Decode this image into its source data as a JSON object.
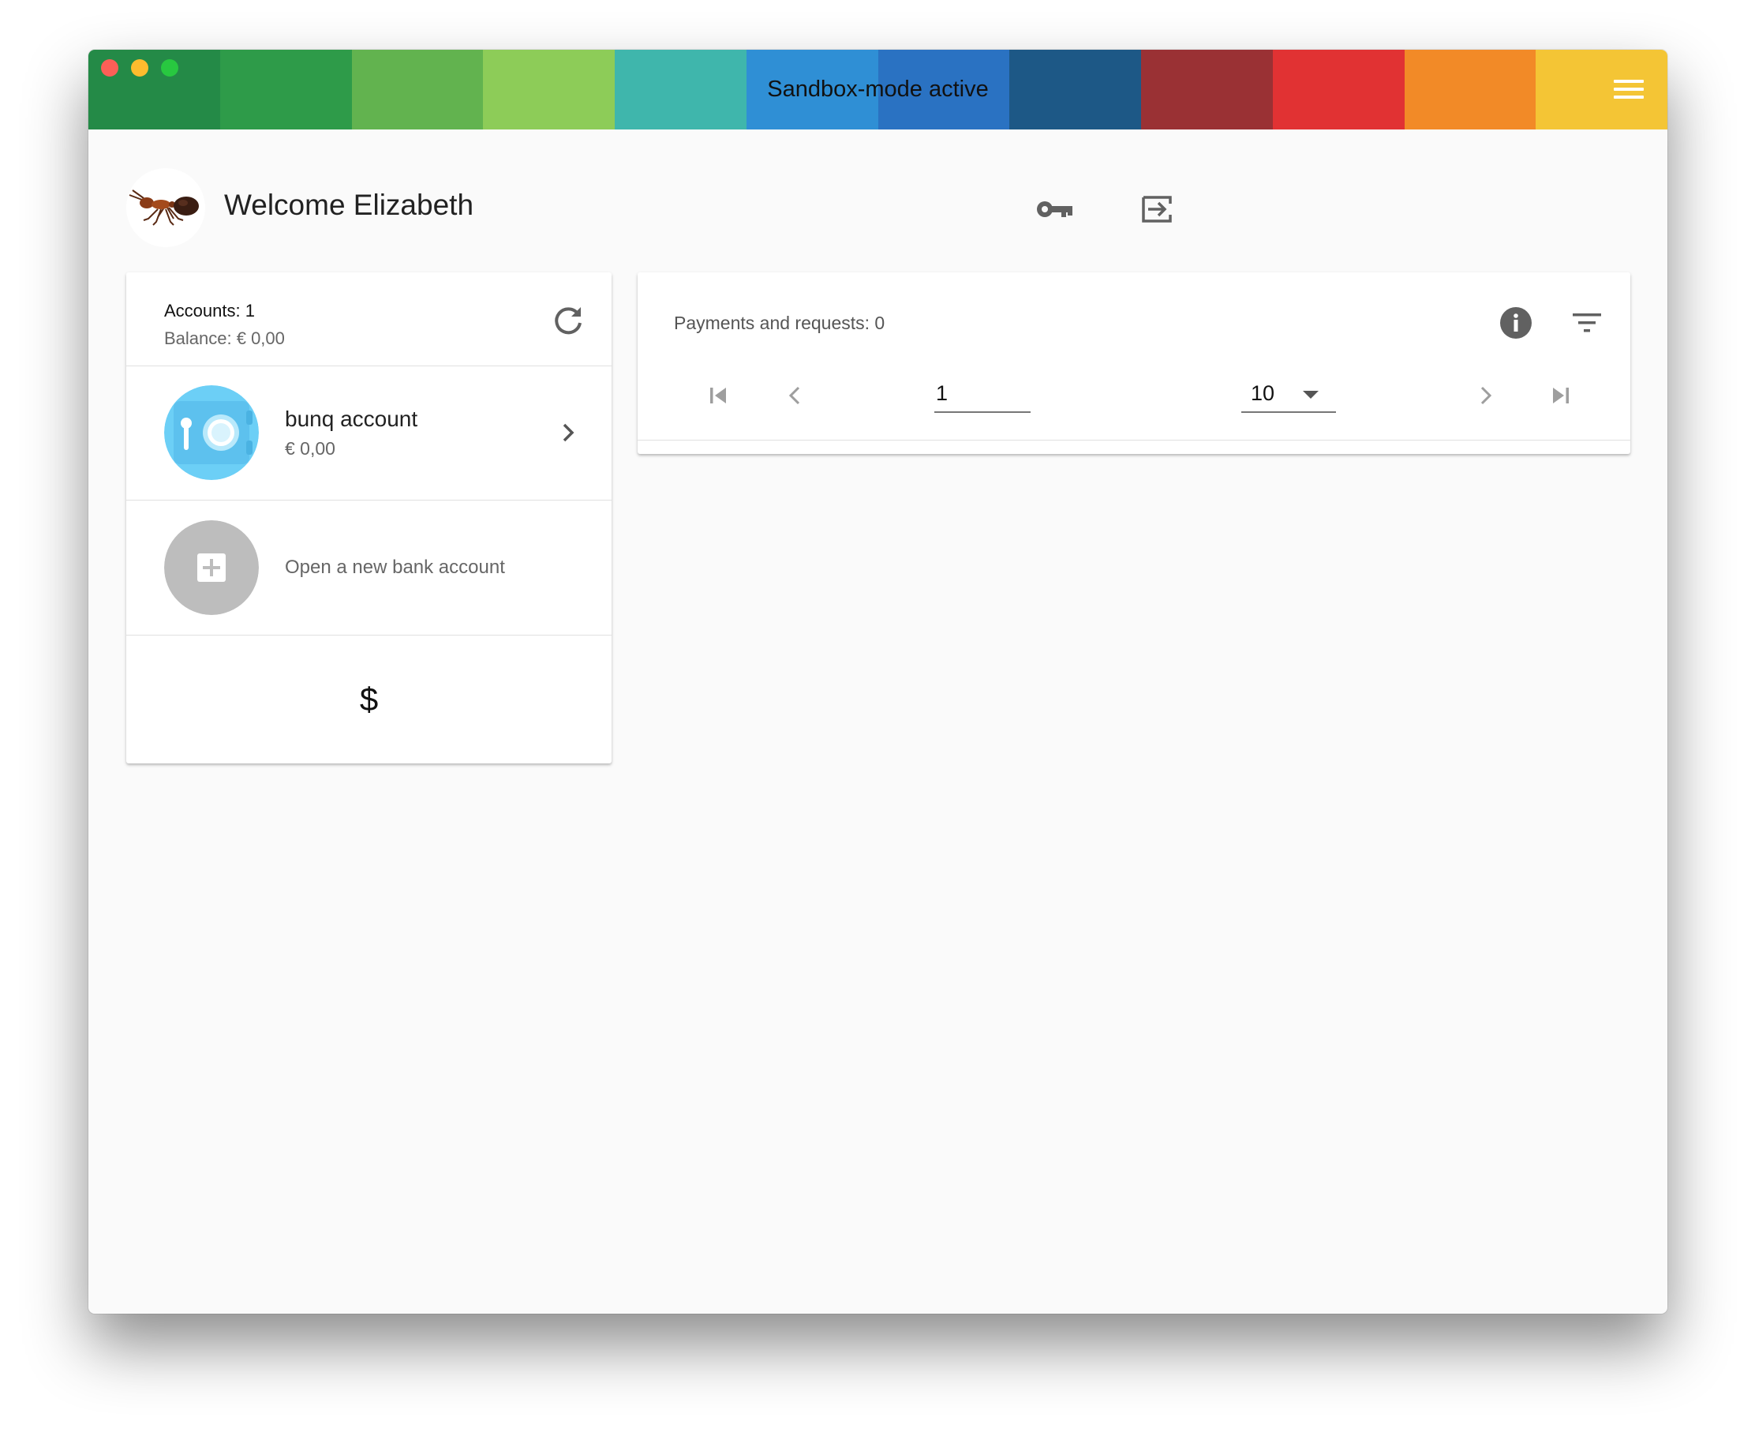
{
  "titlebar": {
    "title": "Sandbox-mode active",
    "stripe_colors": [
      "#248a47",
      "#2e9b49",
      "#62b34f",
      "#8dcc58",
      "#3fb6ac",
      "#2f8fd5",
      "#2a72c2",
      "#1d5886",
      "#9a3134",
      "#e13233",
      "#f28a27",
      "#f4c535"
    ],
    "traffic_lights": [
      "#fd5f57",
      "#febc2e",
      "#28c840"
    ]
  },
  "header": {
    "welcome": "Welcome Elizabeth",
    "avatar_icon": "ant-avatar-icon",
    "key_icon": "key-icon",
    "logout_icon": "logout-icon"
  },
  "accounts": {
    "count_label": "Accounts: 1",
    "balance_label": "Balance: € 0,00",
    "items": [
      {
        "name": "bunq account",
        "amount": "€ 0,00",
        "icon": "safe-icon"
      }
    ],
    "new_account_label": "Open a new bank account",
    "currency_symbol": "$"
  },
  "payments": {
    "title": "Payments and requests: 0",
    "page": "1",
    "per_page": "10"
  },
  "colors": {
    "accent_blue": "#6ccff6",
    "icon_grey": "#616161",
    "placeholder_grey": "#bdbdbd"
  }
}
